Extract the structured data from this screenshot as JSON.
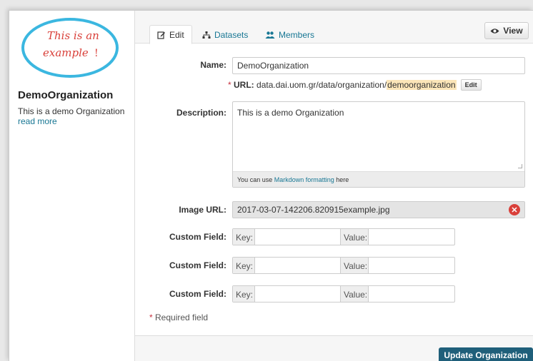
{
  "sidebar": {
    "logo_text_line1": "This is an",
    "logo_text_line2": "example",
    "org_title": "DemoOrganization",
    "org_description": "This is a demo Organization",
    "read_more": "read more"
  },
  "tabs": [
    {
      "label": "Edit",
      "icon": "pencil-square-icon",
      "active": true
    },
    {
      "label": "Datasets",
      "icon": "sitemap-icon",
      "active": false
    },
    {
      "label": "Members",
      "icon": "users-icon",
      "active": false
    }
  ],
  "view_button": {
    "label": "View",
    "icon": "eye-icon"
  },
  "form": {
    "name_label": "Name:",
    "name_value": "DemoOrganization",
    "url_star": "*",
    "url_label": "URL:",
    "url_base": "data.dai.uom.gr/data/organization/",
    "url_slug": "demoorganization",
    "url_edit": "Edit",
    "description_label": "Description:",
    "description_value": "This is a demo Organization",
    "markdown_prefix": "You can use",
    "markdown_link": "Markdown formatting",
    "markdown_suffix": "here",
    "image_url_label": "Image URL:",
    "image_url_value": "2017-03-07-142206.820915example.jpg",
    "custom_fields": [
      {
        "label": "Custom Field:",
        "key_addon": "Key:",
        "value_addon": "Value:"
      },
      {
        "label": "Custom Field:",
        "key_addon": "Key:",
        "value_addon": "Value:"
      },
      {
        "label": "Custom Field:",
        "key_addon": "Key:",
        "value_addon": "Value:"
      }
    ],
    "required_star": "*",
    "required_text": "Required field"
  },
  "footer": {
    "update_button": "Update Organization"
  },
  "colors": {
    "link": "#187794",
    "primary_button": "#1f5f7a",
    "logo_circle": "#3bb7e0",
    "logo_text": "#d9403a"
  }
}
